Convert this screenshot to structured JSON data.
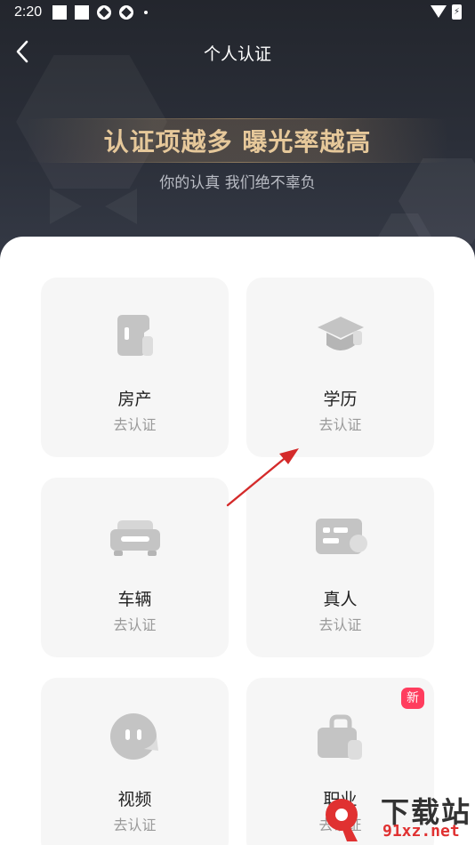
{
  "status_bar": {
    "time": "2:20"
  },
  "nav": {
    "title": "个人认证",
    "back_icon": "chevron-left-icon"
  },
  "hero": {
    "slogan": "认证项越多 曝光率越高",
    "subtitle": "你的认真 我们绝不辜负"
  },
  "tiles": [
    {
      "name": "房产",
      "action": "去认证",
      "icon": "house-icon"
    },
    {
      "name": "学历",
      "action": "去认证",
      "icon": "graduation-cap-icon"
    },
    {
      "name": "车辆",
      "action": "去认证",
      "icon": "car-icon"
    },
    {
      "name": "真人",
      "action": "去认证",
      "icon": "id-card-icon"
    },
    {
      "name": "视频",
      "action": "去认证",
      "icon": "video-face-icon"
    },
    {
      "name": "职业",
      "action": "去认证",
      "icon": "briefcase-icon",
      "badge": "新"
    }
  ],
  "watermark": {
    "title": "下载站",
    "url": "91xz.net"
  },
  "colors": {
    "header_bg": "#25282f",
    "slogan_gold": "#e6c89a",
    "tile_bg": "#f6f6f6",
    "icon_gray": "#c4c4c4",
    "badge_red": "#ff3d5e",
    "arrow_red": "#d42a2a"
  }
}
